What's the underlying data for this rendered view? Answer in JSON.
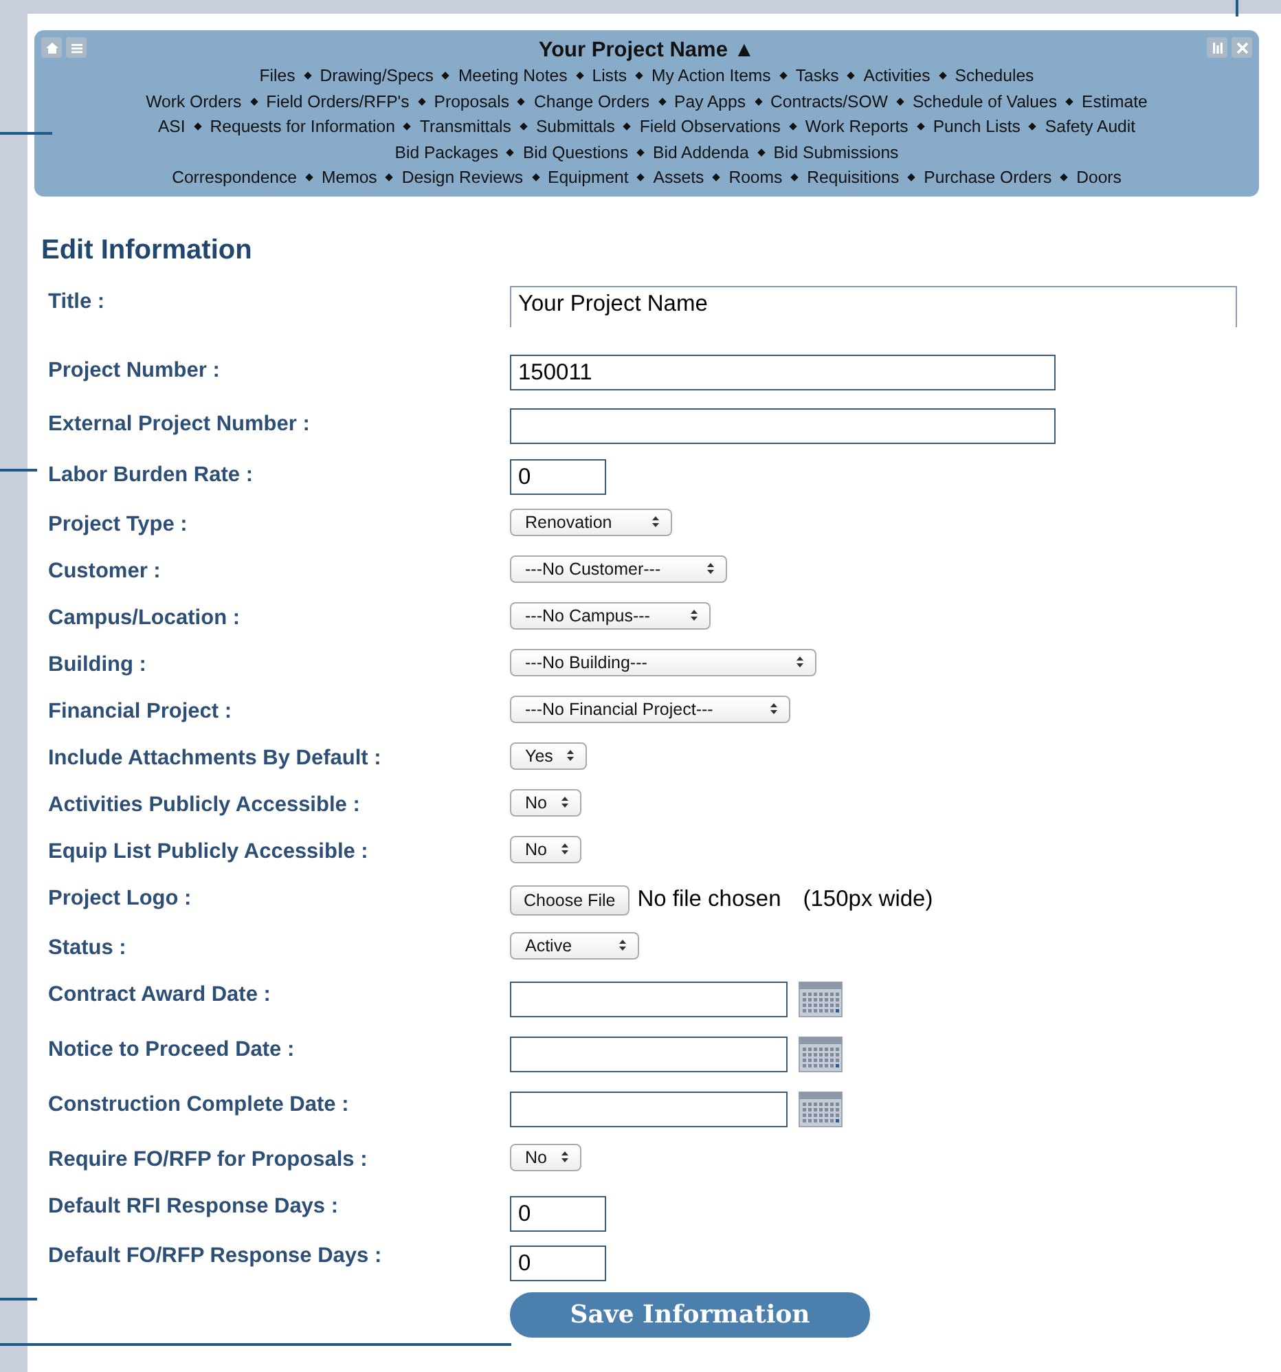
{
  "header": {
    "title": "Your Project Name ▲",
    "nav_rows": [
      [
        "Files",
        "Drawing/Specs",
        "Meeting Notes",
        "Lists",
        "My Action Items",
        "Tasks",
        "Activities",
        "Schedules"
      ],
      [
        "Work Orders",
        "Field Orders/RFP's",
        "Proposals",
        "Change Orders",
        "Pay Apps",
        "Contracts/SOW",
        "Schedule of Values",
        "Estimate"
      ],
      [
        "ASI",
        "Requests for Information",
        "Transmittals",
        "Submittals",
        "Field Observations",
        "Work Reports",
        "Punch Lists",
        "Safety Audit"
      ],
      [
        "Bid Packages",
        "Bid Questions",
        "Bid Addenda",
        "Bid Submissions"
      ],
      [
        "Correspondence",
        "Memos",
        "Design Reviews",
        "Equipment",
        "Assets",
        "Rooms",
        "Requisitions",
        "Purchase Orders",
        "Doors"
      ]
    ]
  },
  "heading": "Edit Information",
  "fields": [
    {
      "label": "Title :",
      "kind": "title",
      "value": "Your Project Name"
    },
    {
      "label": "Project Number :",
      "kind": "wide",
      "value": "150011"
    },
    {
      "label": "External Project Number :",
      "kind": "wide"
    },
    {
      "label": "Labor Burden Rate :",
      "kind": "short",
      "value": "0"
    },
    {
      "label": "Project Type :",
      "kind": "select",
      "value": "Renovation"
    },
    {
      "label": "Customer :",
      "kind": "select",
      "value": "---No Customer---"
    },
    {
      "label": "Campus/Location :",
      "kind": "select",
      "value": "---No Campus---"
    },
    {
      "label": "Building :",
      "kind": "select",
      "value": "---No Building---"
    },
    {
      "label": "Financial Project :",
      "kind": "select",
      "value": "---No Financial Project---"
    },
    {
      "label": "Include Attachments By Default :",
      "kind": "select",
      "value": "Yes"
    },
    {
      "label": "Activities Publicly Accessible :",
      "kind": "select",
      "value": "No"
    },
    {
      "label": "Equip List Publicly Accessible :",
      "kind": "select",
      "value": "No"
    },
    {
      "label": "Project Logo :",
      "kind": "file",
      "button": "Choose File",
      "value": "No file chosen",
      "note": "(150px wide)"
    },
    {
      "label": "Status :",
      "kind": "select",
      "value": "Active"
    },
    {
      "label": "Contract Award Date :",
      "kind": "date"
    },
    {
      "label": "Notice to Proceed Date :",
      "kind": "date"
    },
    {
      "label": "Construction Complete Date :",
      "kind": "date"
    },
    {
      "label": "Require FO/RFP for Proposals :",
      "kind": "select",
      "value": "No"
    },
    {
      "label": "Default RFI Response Days :",
      "kind": "short",
      "value": "0"
    },
    {
      "label": "Default FO/RFP Response Days :",
      "kind": "short",
      "value": "0"
    }
  ],
  "save_button": "Save Information"
}
